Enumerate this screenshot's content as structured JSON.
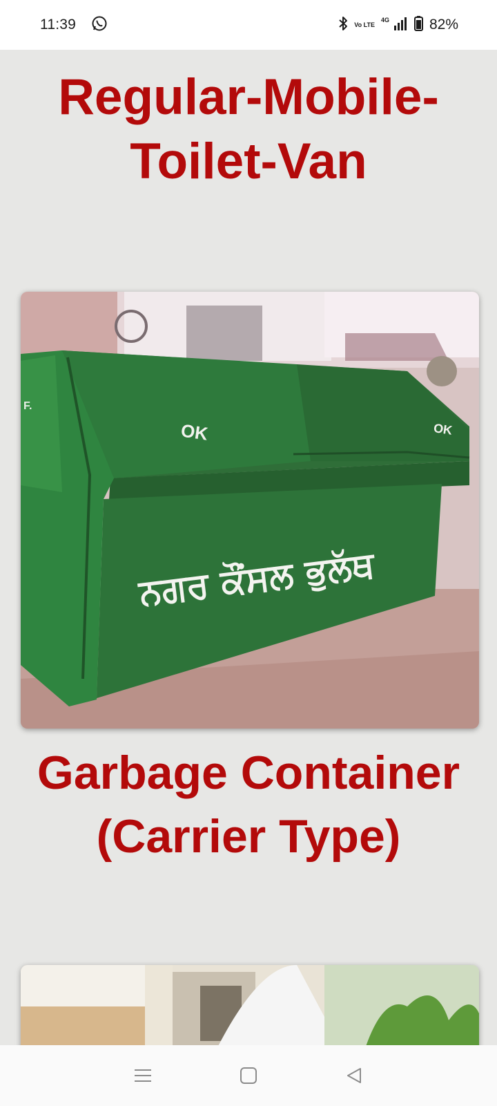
{
  "status_bar": {
    "time": "11:39",
    "battery": "82%",
    "network": "4G",
    "volte": "Vo LTE",
    "icons": [
      "whatsapp-icon",
      "bluetooth-icon",
      "volte-icon",
      "signal-icon",
      "battery-icon"
    ]
  },
  "page": {
    "heading_1": "Regular-Mobile-Toilet-Van",
    "heading_2": "Garbage Container (Carrier Type)",
    "photo_1": {
      "lid_text_left": "OK",
      "lid_text_right": "OK",
      "body_text": "ਨਗਰ ਕੌਂਸਲ ਭੁਲੱਥ",
      "corner_text": "F."
    }
  },
  "nav_bar": {
    "icons": [
      "menu-icon",
      "home-icon",
      "back-icon"
    ]
  },
  "colors": {
    "heading": "#b30a0a",
    "background": "#e7e7e5",
    "container_green": "#2f7a3a"
  }
}
